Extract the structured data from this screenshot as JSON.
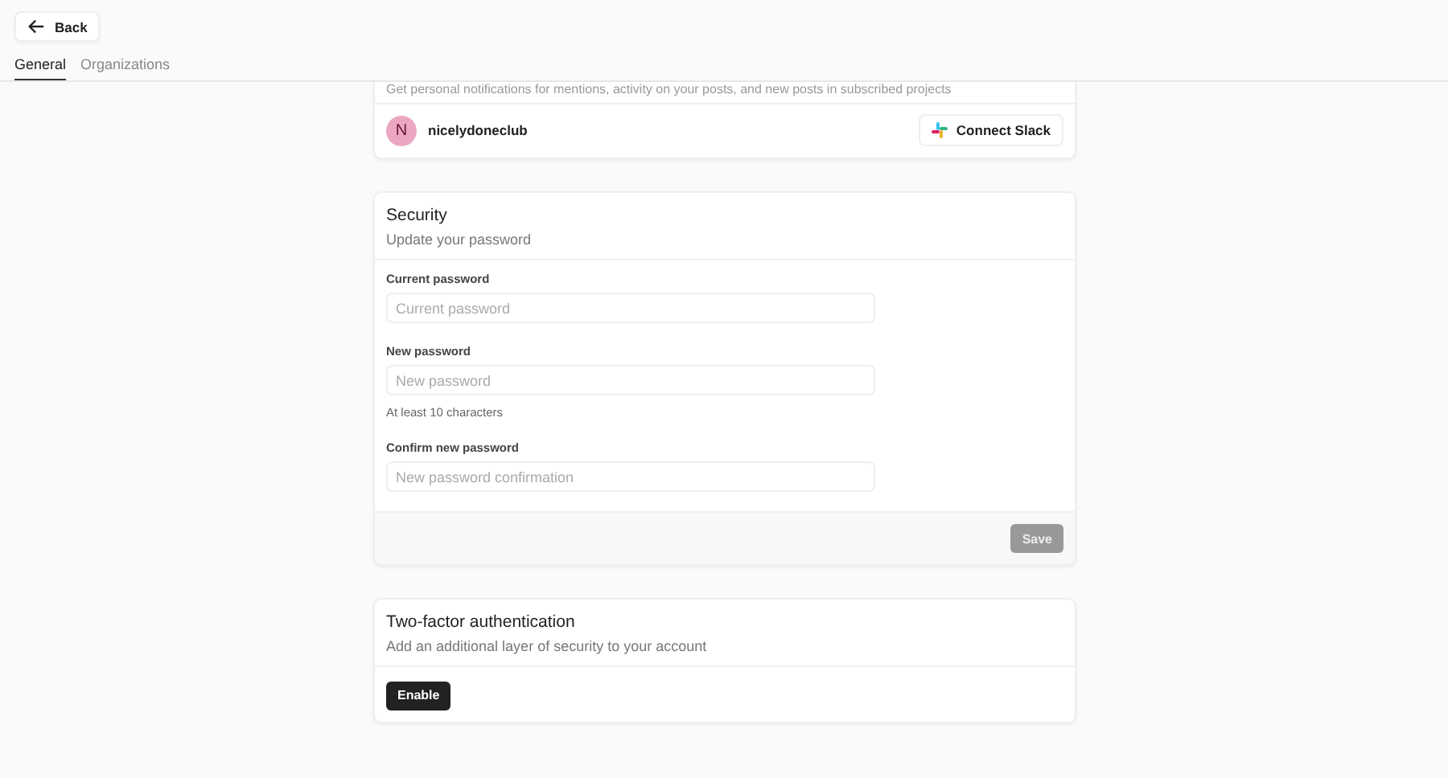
{
  "header": {
    "back_label": "Back"
  },
  "tabs": [
    {
      "label": "General",
      "selected": true
    },
    {
      "label": "Organizations",
      "selected": false
    }
  ],
  "notifications": {
    "description": "Get personal notifications for mentions, activity on your posts, and new posts in subscribed projects",
    "account": {
      "initial": "N",
      "name": "nicelydoneclub"
    },
    "connect_label": "Connect Slack"
  },
  "security": {
    "title": "Security",
    "subtitle": "Update your password",
    "fields": [
      {
        "label": "Current password",
        "placeholder": "Current password"
      },
      {
        "label": "New password",
        "placeholder": "New password",
        "hint": "At least 10 characters"
      },
      {
        "label": "Confirm new password",
        "placeholder": "New password confirmation"
      }
    ],
    "save": {
      "label": "Save",
      "disabled": true
    }
  },
  "two_factor": {
    "title": "Two-factor authentication",
    "subtitle": "Add an additional layer of security to your account",
    "button": {
      "label": "Enable",
      "disabled": false
    }
  }
}
